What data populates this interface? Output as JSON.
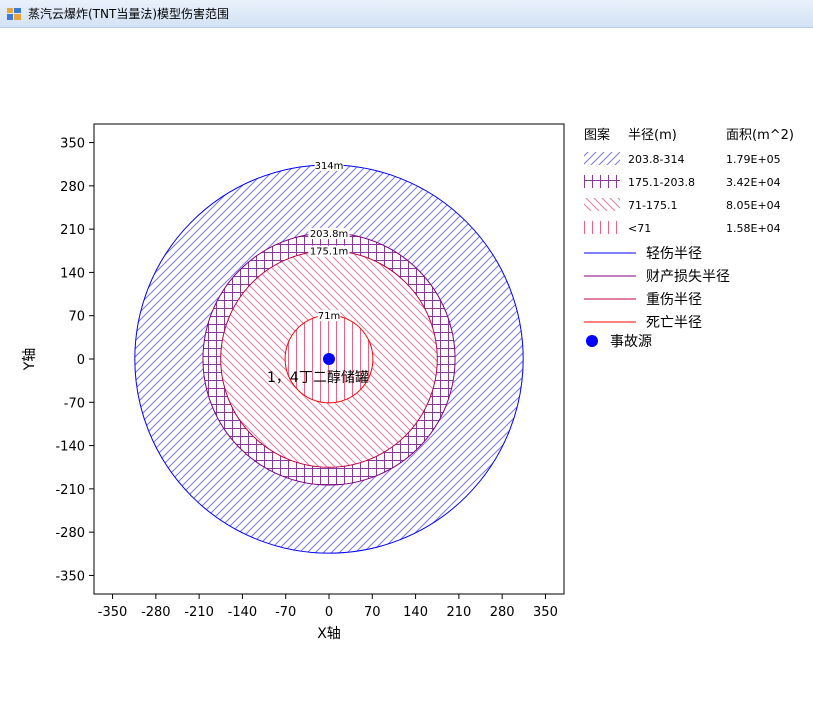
{
  "window": {
    "title": "蒸汽云爆炸(TNT当量法)模型伤害范围",
    "icon": "app-window-icon"
  },
  "chart_data": {
    "type": "circle-zones",
    "xlabel": "X轴",
    "ylabel": "Y轴",
    "xlim": [
      -380,
      380
    ],
    "ylim": [
      -380,
      380
    ],
    "xticks": [
      -350,
      -280,
      -210,
      -140,
      -70,
      0,
      70,
      140,
      210,
      280,
      350
    ],
    "yticks": [
      350,
      280,
      210,
      140,
      70,
      0,
      -70,
      -140,
      -210,
      -280,
      -350
    ],
    "grid": false,
    "center": [
      0,
      0
    ],
    "source_label": "1，4丁二醇储罐",
    "circles": [
      {
        "radius": 314,
        "label": "314m",
        "color": "#0000ff",
        "hatch": "diag-right",
        "hatch_color": "#7777ee"
      },
      {
        "radius": 203.8,
        "label": "203.8m",
        "color": "#800080",
        "hatch": "cross",
        "hatch_color": "#8a3a9a"
      },
      {
        "radius": 175.1,
        "label": "175.1m",
        "color": "#c00040",
        "hatch": "diag-left",
        "hatch_color": "#e07da0"
      },
      {
        "radius": 71,
        "label": "71m",
        "color": "#ff0000",
        "hatch": "vertical",
        "hatch_color": "#f06080"
      }
    ],
    "legend": {
      "header": [
        "图案",
        "半径(m)",
        "面积(m^2)"
      ],
      "position": "right",
      "pattern_rows": [
        {
          "range": "203.8-314",
          "area": "1.79E+05",
          "hatch": "diag-right",
          "color": "#7777ee"
        },
        {
          "range": "175.1-203.8",
          "area": "3.42E+04",
          "hatch": "cross",
          "color": "#8a3a9a"
        },
        {
          "range": "71-175.1",
          "area": "8.05E+04",
          "hatch": "diag-left",
          "color": "#e07da0"
        },
        {
          "range": "<71",
          "area": "1.58E+04",
          "hatch": "vertical",
          "color": "#f06080"
        }
      ],
      "line_rows": [
        {
          "label": "轻伤半径",
          "color": "#0000ff"
        },
        {
          "label": "财产损失半径",
          "color": "#800080"
        },
        {
          "label": "重伤半径",
          "color": "#c00040"
        },
        {
          "label": "死亡半径",
          "color": "#ff0000"
        }
      ],
      "marker_row": {
        "label": "事故源",
        "color": "#0000ff"
      }
    }
  }
}
